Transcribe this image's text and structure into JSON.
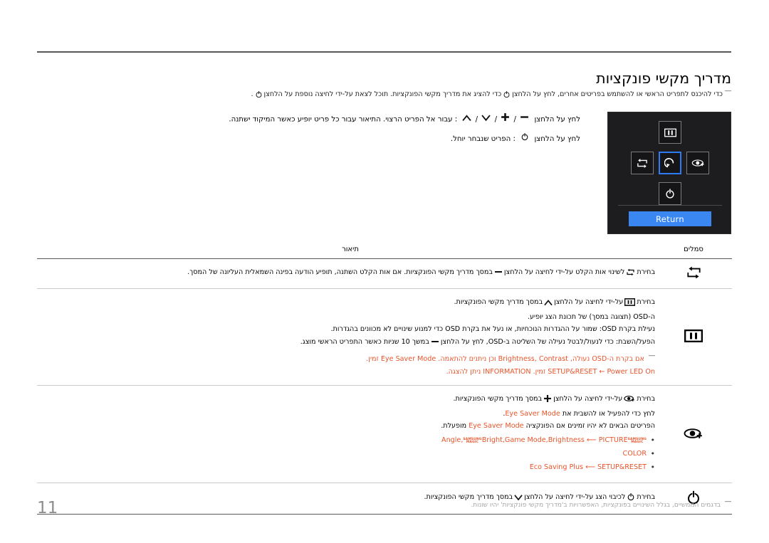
{
  "document": {
    "title": "מדריך מקשי פונקציות",
    "page_number": "11",
    "intro_note": "כדי להיכנס לתפריט הראשי או להשתמש בפריטים אחרים, לחץ על הלחצן    כדי להציג את מדריך מקשי הפונקציות. תוכל לצאת על-ידי לחיצה נוספת על הלחצן   .",
    "footer_note": "בדגמים הממשיים, בגלל השינויים בפונקציות, האפשרויות ב'מדריך מקשי פונקציות' יהיו שונות."
  },
  "instructions": {
    "line1_prefix": "לחץ על הלחצן",
    "line1_keys": [
      "up-arrow",
      "down-arrow",
      "plus",
      "minus"
    ],
    "line1_suffix": ": עבור אל הפריט הרצוי. התיאור עבור כל פריט יופיע כאשר המיקוד ישתנה.",
    "line2_prefix": "לחץ על הלחצן",
    "line2_keys": [
      "power"
    ],
    "line2_suffix": ": הפריט שנבחר יוחל."
  },
  "osd_panel": {
    "buttons": {
      "up": "menu-icon",
      "left": "source-icon",
      "center": "return-icon",
      "right": "eye-saver-icon",
      "down": "power-icon"
    },
    "return_label": "Return",
    "accent_color": "#3a87f2"
  },
  "table": {
    "headers": {
      "symbols": "סמלים",
      "description": "תיאור"
    },
    "rows": [
      {
        "symbol": "source-icon",
        "lines": [
          {
            "text": "בחירת   לשינוי אות הקלט על-ידי לחיצה על הלחצן   במסך מדריך מקשי הפונקציות. אם אות הקלט השתנה, תופיע הודעה בפינה השמאלית העליונה של המסך.",
            "style": "normal"
          }
        ]
      },
      {
        "symbol": "menu-icon",
        "lines": [
          {
            "text": "בחירת   על-ידי לחיצה על הלחצן   במסך מדריך מקשי הפונקציות.",
            "style": "normal"
          },
          {
            "text": "ה-OSD (תצוגה במסך) של תכונת הצג יופיע.",
            "style": "normal"
          },
          {
            "text": "נעילת בקרת OSD: שמור על ההגדרות הנוכחיות, או נעל את בקרת OSD כדי למנוע שינויים לא מכוונים בהגדרות.",
            "style": "normal"
          },
          {
            "text": "הפעל/השבת: כדי לנעול/לבטל נעילה של השליטה ב-OSD, לחץ על הלחצן   במשך 10 שניות כאשר התפריט הראשי מוצג.",
            "style": "normal"
          },
          {
            "text": "אם בקרת ה-OSD נעולה, Brightness, Contrast וכן ניתנים להתאמה. Eye Saver Mode זמין.",
            "style": "note"
          },
          {
            "text": "SETUP&RESET ← Power LED On זמין. INFORMATION ניתן להצגה.",
            "style": "note"
          }
        ]
      },
      {
        "symbol": "eye-saver-icon",
        "lines": [
          {
            "text": "בחירת   על-ידי לחיצה על הלחצן   במסך מדריך מקשי הפונקציות.",
            "style": "normal"
          },
          {
            "text": "לחץ כדי להפעיל או להשבית את Eye Saver Mode.",
            "style": "normal"
          },
          {
            "text": "הפריטים הבאים לא יהיו זמינים אם הפונקציה Eye Saver Mode מופעלת.",
            "style": "normal"
          }
        ],
        "bullets": [
          "PICTURE ← Brightness, Game Mode, MAGICBright, MAGICAngle",
          "COLOR",
          "SETUP&RESET ← Eco Saving Plus"
        ]
      },
      {
        "symbol": "power-icon",
        "lines": [
          {
            "text": "בחירת   לכיבוי הצג על-ידי לחיצה על הלחצן   במסך מדריך מקשי הפונקציות.",
            "style": "normal"
          }
        ]
      }
    ],
    "bullet_labels": {
      "picture_menu": "PICTURE",
      "picture_items": [
        "Brightness",
        "Game Mode",
        "Bright",
        "Angle"
      ],
      "color_menu": "COLOR",
      "setup_menu": "SETUP&RESET",
      "setup_item": "Eco Saving Plus",
      "magic_brand_top": "SAMSUNG",
      "magic_brand_bottom": "MAGIC"
    }
  },
  "colors": {
    "accent_orange": "#e8542a",
    "accent_blue": "#3a87f2",
    "rule": "#58585a"
  }
}
